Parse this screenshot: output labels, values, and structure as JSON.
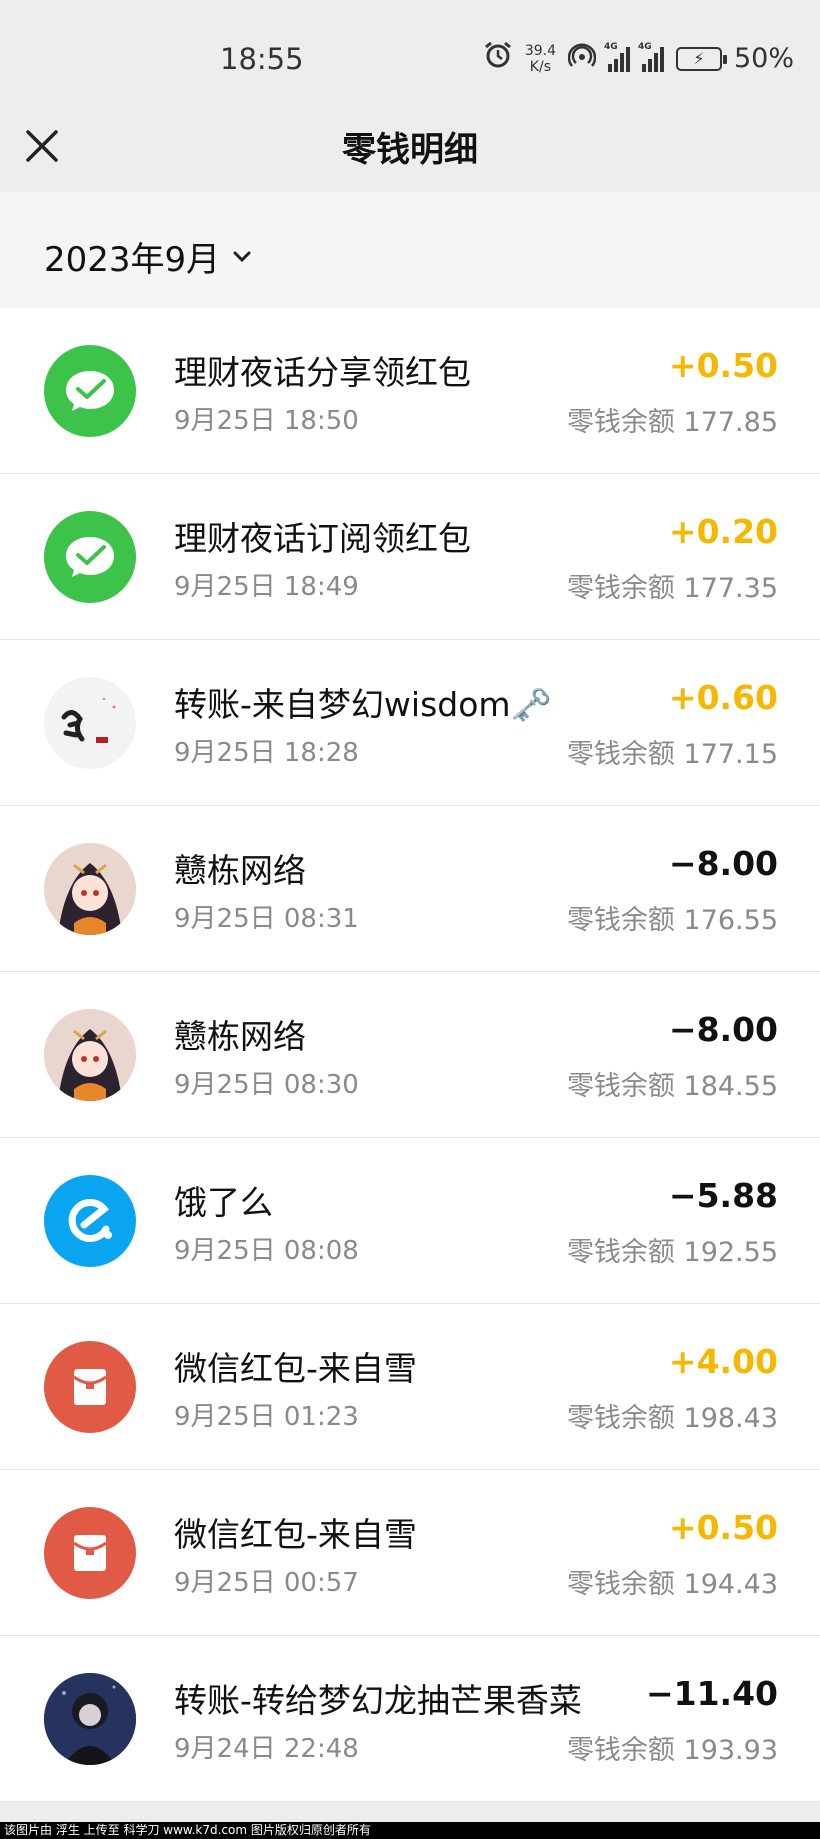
{
  "status_bar": {
    "time": "18:55",
    "net_speed_value": "39.4",
    "net_speed_unit": "K/s",
    "sim_tag_1": "4G",
    "sim_tag_2": "4G",
    "battery_text": "50%",
    "icons": [
      "alarm-icon",
      "hotspot-icon",
      "signal-icon",
      "signal-icon",
      "battery-icon"
    ]
  },
  "nav": {
    "title": "零钱明细",
    "close_icon": "close-icon"
  },
  "filter": {
    "month": "2023年9月",
    "icon": "chevron-down-icon"
  },
  "colors": {
    "income": "#f5b700",
    "expense": "#111111",
    "wechat_green": "#3dc34a",
    "eleme_blue": "#0aa5f0",
    "redpacket": "#e05a45"
  },
  "transactions": [
    {
      "title": "理财夜话分享领红包",
      "date": "9月25日 18:50",
      "amount": "+0.50",
      "balance": "零钱余额 177.85",
      "avatar": "wechat-pay-icon"
    },
    {
      "title": "理财夜话订阅领红包",
      "date": "9月25日 18:49",
      "amount": "+0.20",
      "balance": "零钱余额 177.35",
      "avatar": "wechat-pay-icon"
    },
    {
      "title": "转账-来自梦幻wisdom🗝️",
      "date": "9月25日 18:28",
      "amount": "+0.60",
      "balance": "零钱余额 177.15",
      "avatar": "calligraphy-avatar"
    },
    {
      "title": "戆栋网络",
      "date": "9月25日 08:31",
      "amount": "−8.00",
      "balance": "零钱余额 176.55",
      "avatar": "anime-girl-avatar"
    },
    {
      "title": "戆栋网络",
      "date": "9月25日 08:30",
      "amount": "−8.00",
      "balance": "零钱余额 184.55",
      "avatar": "anime-girl-avatar"
    },
    {
      "title": "饿了么",
      "date": "9月25日 08:08",
      "amount": "−5.88",
      "balance": "零钱余额 192.55",
      "avatar": "eleme-icon"
    },
    {
      "title": "微信红包-来自雪",
      "date": "9月25日 01:23",
      "amount": "+4.00",
      "balance": "零钱余额 198.43",
      "avatar": "red-packet-icon"
    },
    {
      "title": "微信红包-来自雪",
      "date": "9月25日 00:57",
      "amount": "+0.50",
      "balance": "零钱余额 194.43",
      "avatar": "red-packet-icon"
    },
    {
      "title": "转账-转给梦幻龙抽芒果香菜",
      "date": "9月24日 22:48",
      "amount": "−11.40",
      "balance": "零钱余额 193.93",
      "avatar": "dark-portrait-avatar"
    }
  ],
  "footer_text": "该图片由 浮生 上传至 科学刀 www.k7d.com 图片版权归原创者所有"
}
